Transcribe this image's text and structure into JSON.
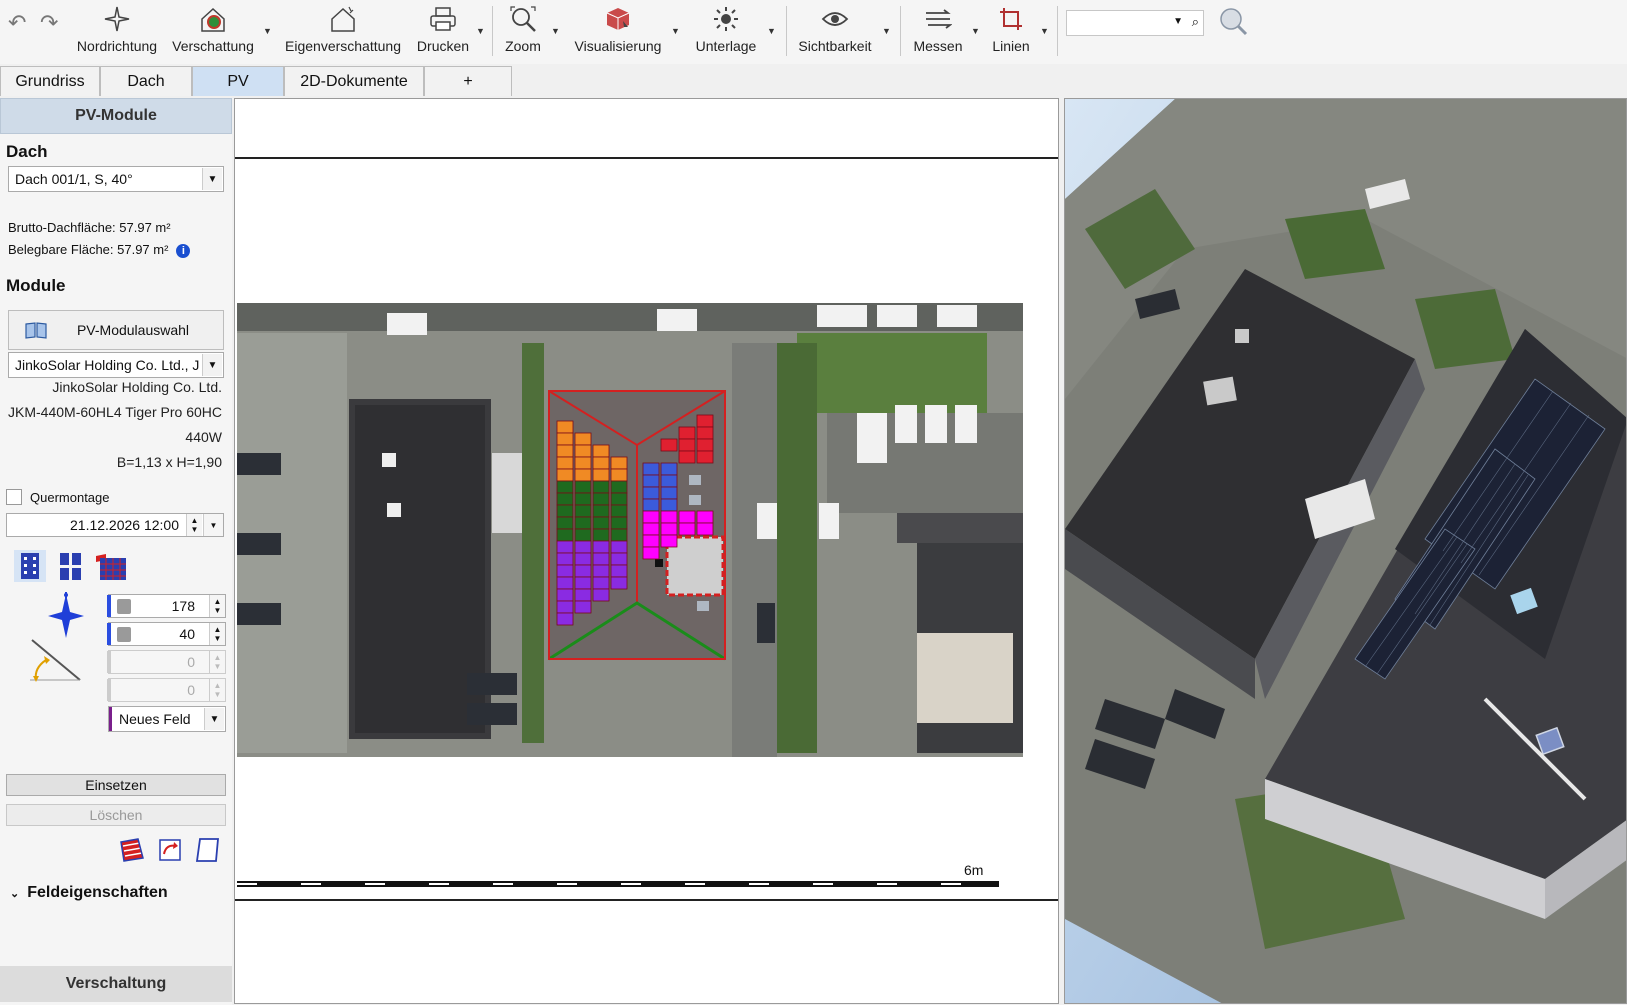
{
  "toolbar": {
    "buttons": [
      {
        "label": "Nordrichtung",
        "icon": "compass-icon"
      },
      {
        "label": "Verschattung",
        "icon": "shading-icon"
      },
      {
        "label": "Eigenverschattung",
        "icon": "self-shading-icon"
      },
      {
        "label": "Drucken",
        "icon": "printer-icon"
      },
      {
        "label": "Zoom",
        "icon": "zoom-icon"
      },
      {
        "label": "Visualisierung",
        "icon": "cube-icon"
      },
      {
        "label": "Unterlage",
        "icon": "sun-icon"
      },
      {
        "label": "Sichtbarkeit",
        "icon": "eye-icon"
      },
      {
        "label": "Messen",
        "icon": "measure-icon"
      },
      {
        "label": "Linien",
        "icon": "crop-lines-icon"
      }
    ],
    "search": {
      "value": ""
    }
  },
  "tabs": [
    {
      "label": "Grundriss",
      "active": false
    },
    {
      "label": "Dach",
      "active": false
    },
    {
      "label": "PV",
      "active": true
    },
    {
      "label": "2D-Dokumente",
      "active": false
    },
    {
      "label": "+",
      "active": false
    }
  ],
  "panel": {
    "header": "PV-Module",
    "roof_title": "Dach",
    "roof_select": "Dach 001/1, S, 40°",
    "gross_area": "Brutto-Dachfläche: 57.97 m²",
    "usable_area": "Belegbare Fläche: 57.97 m²",
    "modules_title": "Module",
    "module_button": "PV-Modulauswahl",
    "module_select": "JinkoSolar Holding Co. Ltd., J",
    "manufacturer": "JinkoSolar Holding Co. Ltd.",
    "model": "JKM-440M-60HL4 Tiger Pro 60HC",
    "power": "440W",
    "dimensions": "B=1,13 x H=1,90",
    "cross_mount": "Quermontage",
    "datetime": "21.12.2026 12:00",
    "azimuth": "178",
    "tilt": "40",
    "field3": "0",
    "field4": "0",
    "field_select": "Neues Feld",
    "insert_button": "Einsetzen",
    "delete_button": "Löschen",
    "field_props": "Feldeigenschaften",
    "wiring": "Verschaltung"
  },
  "view2d": {
    "scale_label": "6m"
  },
  "colors": {
    "accent": "#cfe0f3",
    "roof_outline": "#d42020",
    "ridge_green": "#1a8c1a",
    "orange": "#f08a24",
    "green": "#1f6a1f",
    "purple": "#8a2be2",
    "blue": "#3b5bdb",
    "magenta": "#ff00ff",
    "red": "#e02030"
  }
}
